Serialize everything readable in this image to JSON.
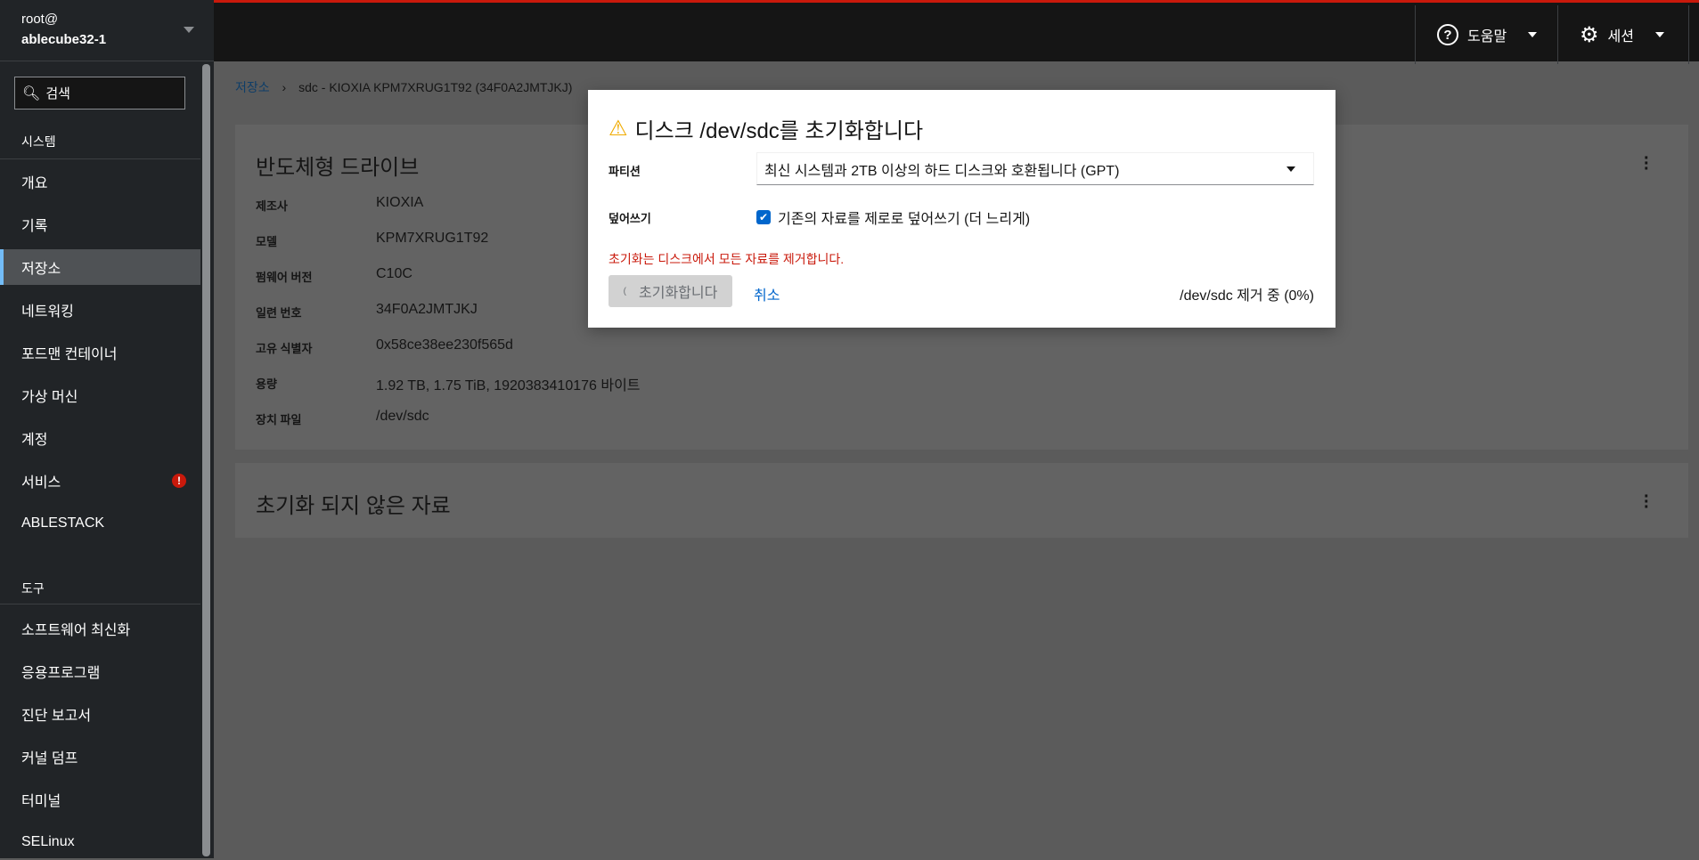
{
  "host": {
    "user": "root@",
    "name": "ablecube32-1"
  },
  "search": {
    "placeholder": "검색"
  },
  "nav": {
    "system_header": "시스템",
    "system_items": [
      {
        "label": "개요"
      },
      {
        "label": "기록"
      },
      {
        "label": "저장소",
        "active": true
      },
      {
        "label": "네트워킹"
      },
      {
        "label": "포드맨 컨테이너"
      },
      {
        "label": "가상 머신"
      },
      {
        "label": "계정"
      },
      {
        "label": "서비스",
        "badge": "!"
      },
      {
        "label": "ABLESTACK"
      }
    ],
    "tools_header": "도구",
    "tools_items": [
      {
        "label": "소프트웨어 최신화"
      },
      {
        "label": "응용프로그램"
      },
      {
        "label": "진단 보고서"
      },
      {
        "label": "커널 덤프"
      },
      {
        "label": "터미널"
      },
      {
        "label": "SELinux"
      }
    ]
  },
  "topbar": {
    "help": "도움말",
    "session": "세션"
  },
  "breadcrumb": {
    "root": "저장소",
    "current": "sdc - KIOXIA KPM7XRUG1T92 (34F0A2JMTJKJ)"
  },
  "drive_card": {
    "title": "반도체형 드라이브",
    "rows": [
      {
        "k": "제조사",
        "v": "KIOXIA"
      },
      {
        "k": "모델",
        "v": "KPM7XRUG1T92"
      },
      {
        "k": "펌웨어 버전",
        "v": "C10C"
      },
      {
        "k": "일련 번호",
        "v": "34F0A2JMTJKJ"
      },
      {
        "k": "고유 식별자",
        "v": "0x58ce38ee230f565d"
      },
      {
        "k": "용량",
        "v": "1.92 TB, 1.75 TiB, 1920383410176 바이트"
      },
      {
        "k": "장치 파일",
        "v": "/dev/sdc"
      }
    ]
  },
  "content_card": {
    "title": "초기화 되지 않은 자료"
  },
  "modal": {
    "title": "디스크 /dev/sdc를 초기화합니다",
    "partition_label": "파티션",
    "partition_value": "최신 시스템과 2TB 이상의 하드 디스크와 호환됩니다 (GPT)",
    "overwrite_label": "덮어쓰기",
    "overwrite_checkbox": "기존의 자료를 제로로 덮어쓰기 (더 느리게)",
    "overwrite_checked": true,
    "warning": "초기화는 디스크에서 모든 자료를 제거합니다.",
    "init_button": "초기화합니다",
    "cancel_button": "취소",
    "status": "/dev/sdc 제거 중 (0%)"
  }
}
